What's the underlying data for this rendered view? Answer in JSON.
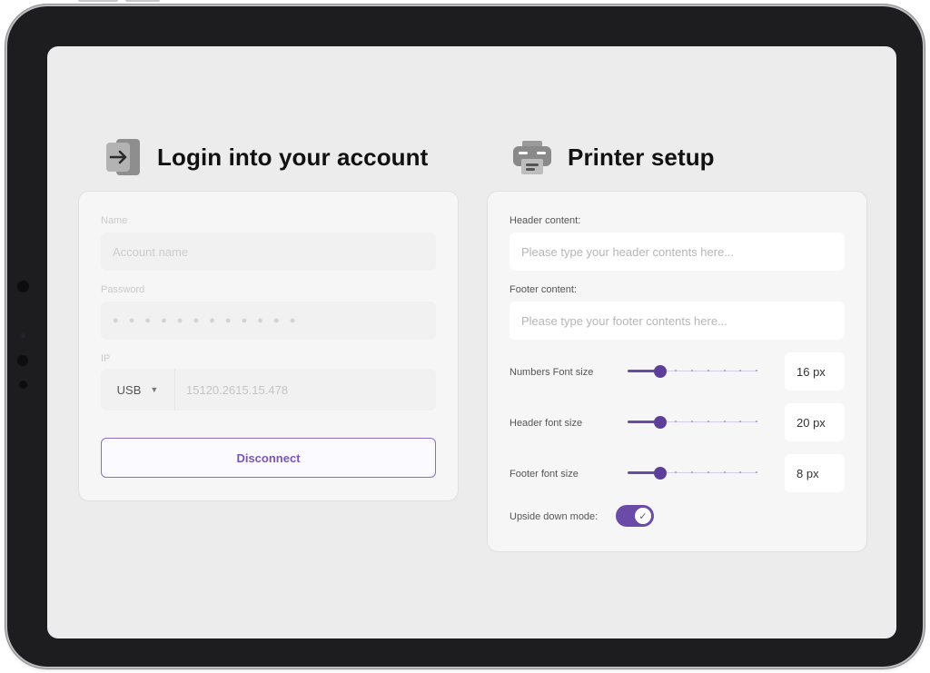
{
  "login": {
    "title": "Login into your account",
    "name_label": "Name",
    "name_placeholder": "Account name",
    "password_label": "Password",
    "password_value": "● ● ● ● ● ● ● ● ● ● ● ●",
    "ip_label": "IP",
    "connection_type": "USB",
    "ip_value": "15120.2615.15.478",
    "disconnect_label": "Disconnect"
  },
  "printer": {
    "title": "Printer setup",
    "header_label": "Header content:",
    "header_placeholder": "Please type your header contents here...",
    "footer_label": "Footer content:",
    "footer_placeholder": "Please type your footer contents here...",
    "sliders": [
      {
        "label": "Numbers Font size",
        "value": "16 px",
        "fraction": 0.25
      },
      {
        "label": "Header font size",
        "value": "20 px",
        "fraction": 0.25
      },
      {
        "label": "Footer font size",
        "value": "8 px",
        "fraction": 0.25
      }
    ],
    "upside_down_label": "Upside down mode:",
    "upside_down_on": true
  },
  "colors": {
    "accent": "#6a4ba7",
    "screen_bg": "#ececec",
    "card_bg": "#f6f6f6"
  },
  "icons": [
    "login-arrow-icon",
    "printer-icon",
    "caret-down-icon",
    "check-icon"
  ]
}
